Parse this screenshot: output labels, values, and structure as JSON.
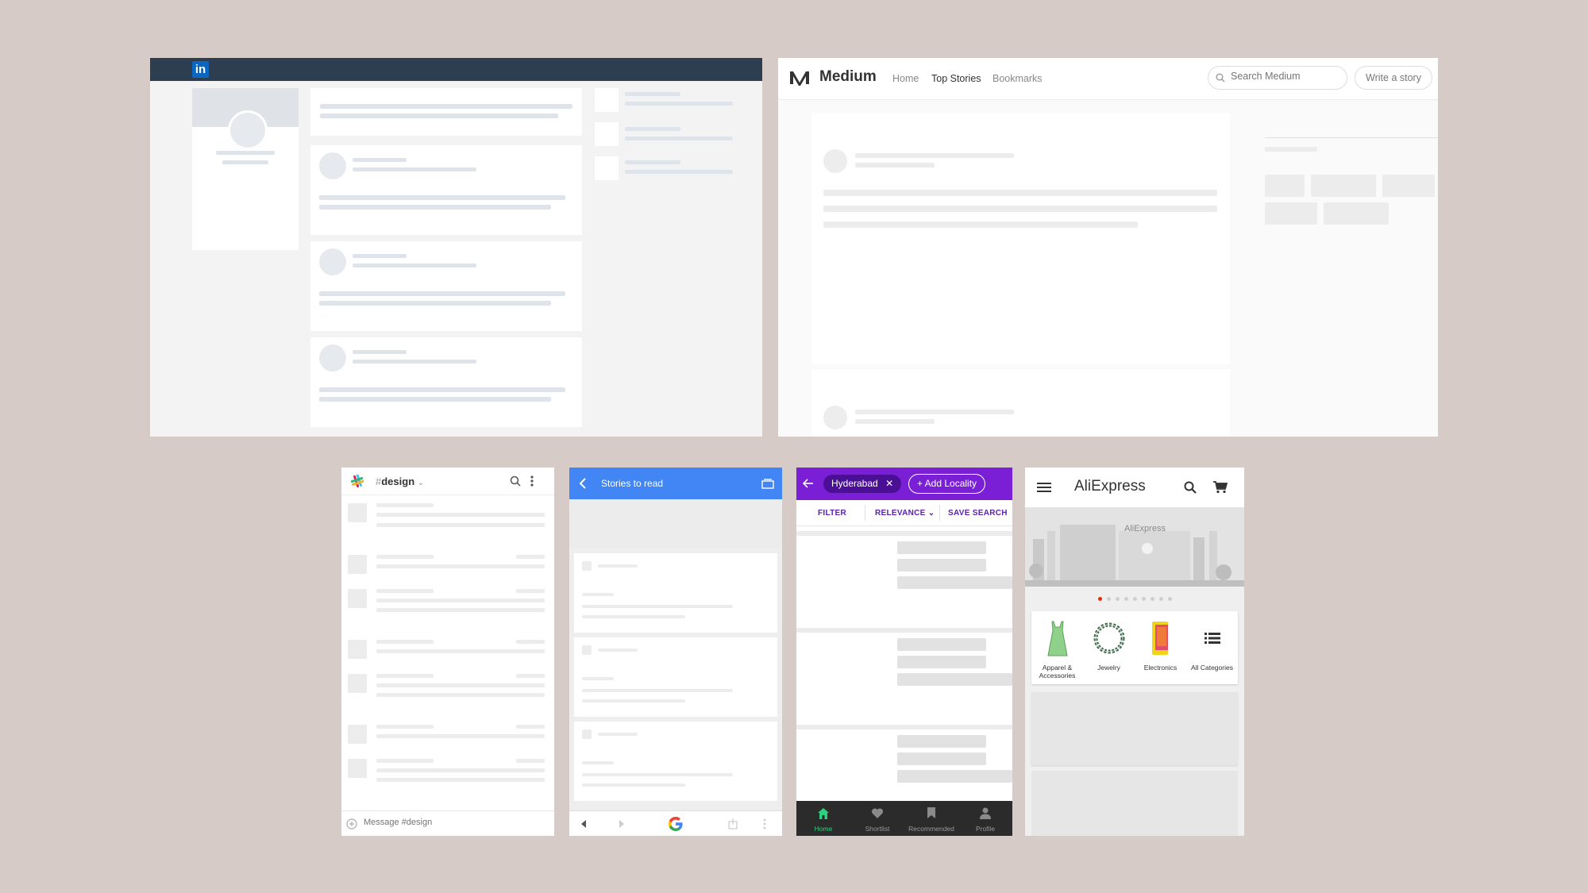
{
  "linkedin": {
    "logo": "in"
  },
  "medium": {
    "brand": "Medium",
    "nav": [
      "Home",
      "Top Stories",
      "Bookmarks"
    ],
    "active_nav": "Top Stories",
    "search_placeholder": "Search Medium",
    "write_label": "Write a story"
  },
  "slack": {
    "channel_hash": "#",
    "channel_name": "design",
    "channel_caret": "⌄",
    "message_placeholder": "Message #design"
  },
  "chrome": {
    "title": "Stories to read"
  },
  "property": {
    "location_chip": "Hyderabad",
    "add_locality": "+ Add Locality",
    "tabs": [
      "FILTER",
      "RELEVANCE",
      "SAVE SEARCH"
    ],
    "nav": [
      "Home",
      "Shortlist",
      "Recommended",
      "Profile"
    ],
    "active_nav": "Home",
    "accent": "#7a1fd6"
  },
  "aliexpress": {
    "brand": "AliExpress",
    "banner_text": "AliExpress",
    "categories": [
      "Apparel & Accessories",
      "Jewelry",
      "Electronics",
      "All Categories"
    ],
    "carousel_dots": 9,
    "active_dot": 0,
    "accent": "#e62e04"
  }
}
